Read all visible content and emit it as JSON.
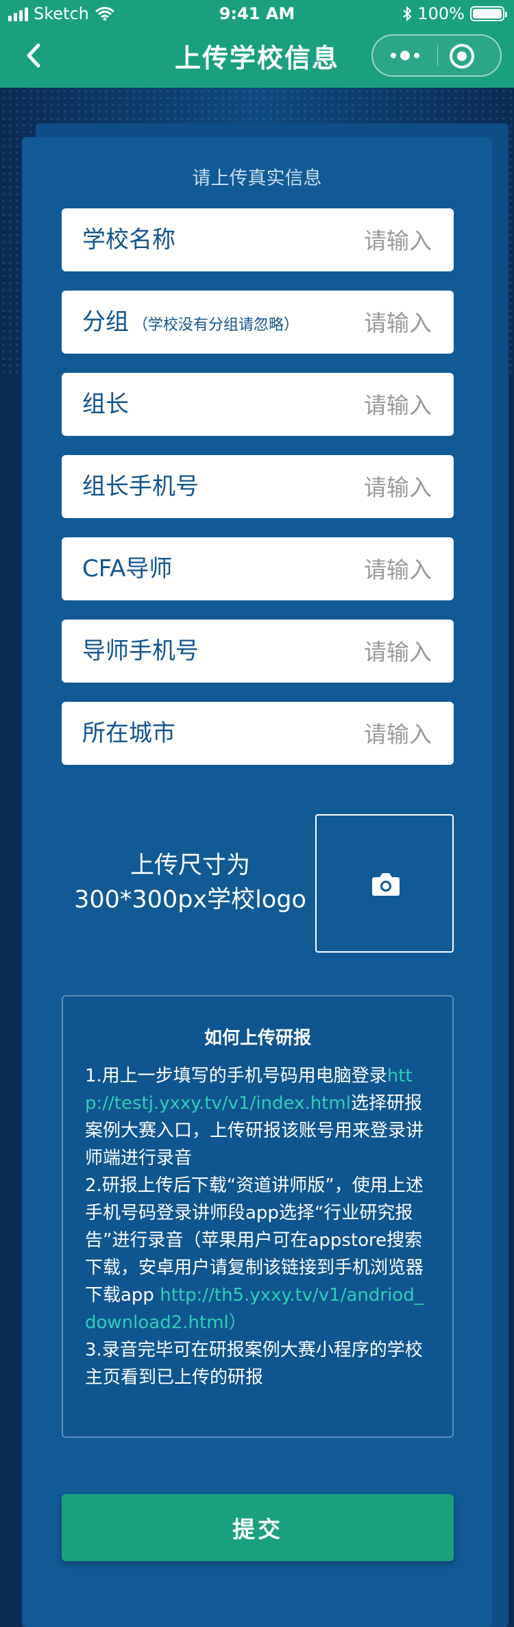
{
  "status_bar": {
    "carrier": "Sketch",
    "time": "9:41 AM",
    "battery": "100%",
    "battery_level": 1.0
  },
  "nav": {
    "title": "上传学校信息"
  },
  "form": {
    "subtitle": "请上传真实信息",
    "fields": [
      {
        "label": "学校名称",
        "hint": "",
        "placeholder": "请输入"
      },
      {
        "label": "分组",
        "hint": "（学校没有分组请忽略）",
        "placeholder": "请输入"
      },
      {
        "label": "组长",
        "hint": "",
        "placeholder": "请输入"
      },
      {
        "label": "组长手机号",
        "hint": "",
        "placeholder": "请输入"
      },
      {
        "label": "CFA导师",
        "hint": "",
        "placeholder": "请输入"
      },
      {
        "label": "导师手机号",
        "hint": "",
        "placeholder": "请输入"
      },
      {
        "label": "所在城市",
        "hint": "",
        "placeholder": "请输入"
      }
    ]
  },
  "upload": {
    "line1": "上传尺寸为",
    "line2": "300*300px学校logo",
    "icon": "camera-icon"
  },
  "howto": {
    "title": "如何上传研报",
    "step1_a": "1.用上一步填写的手机号码用电脑登录",
    "step1_link": "http://testj.yxxy.tv/v1/index.html",
    "step1_b": "选择研报案例大赛入口，上传研报该账号用来登录讲师端进行录音",
    "step2_a": "2.研报上传后下载“资道讲师版”，使用上述手机号码登录讲师段app选择“行业研究报告”进行录音（苹果用户可在appstore搜索下载，安卓用户请复制该链接到手机浏览器下载app ",
    "step2_link": "http://th5.yxxy.tv/v1/andriod_download2.html",
    "step2_b": "）",
    "step3": "3.录音完毕可在研报案例大赛小程序的学校主页看到已上传的研报"
  },
  "submit_label": "提交",
  "colors": {
    "accent": "#1aa07e",
    "card": "#115a95",
    "label": "#13548d",
    "link": "#2bd0b6"
  }
}
